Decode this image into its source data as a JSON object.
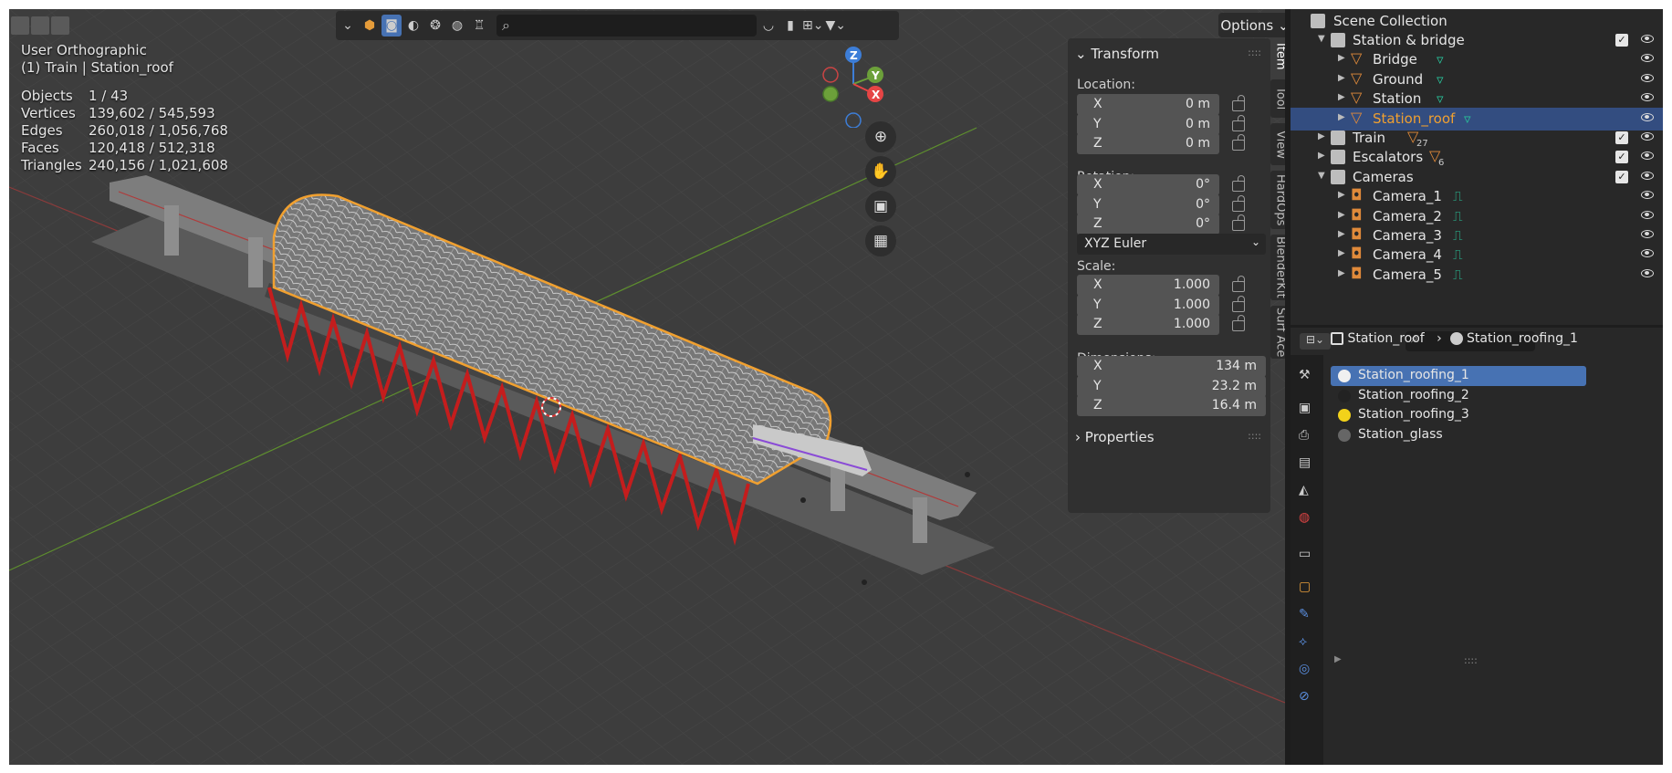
{
  "viewport": {
    "view_name": "User Orthographic",
    "context": "(1) Train | Station_roof",
    "stats": [
      {
        "label": "Objects",
        "value": "1 / 43"
      },
      {
        "label": "Vertices",
        "value": "139,602 / 545,593"
      },
      {
        "label": "Edges",
        "value": "260,018 / 1,056,768"
      },
      {
        "label": "Faces",
        "value": "120,418 / 512,318"
      },
      {
        "label": "Triangles",
        "value": "240,156 / 1,021,608"
      }
    ],
    "options_label": "Options",
    "gizmo": {
      "z": "Z",
      "y": "Y",
      "x": "X"
    }
  },
  "npanel": {
    "transform_label": "Transform",
    "location_label": "Location:",
    "location": [
      {
        "axis": "X",
        "value": "0 m"
      },
      {
        "axis": "Y",
        "value": "0 m"
      },
      {
        "axis": "Z",
        "value": "0 m"
      }
    ],
    "rotation_label": "Rotation:",
    "rotation": [
      {
        "axis": "X",
        "value": "0°"
      },
      {
        "axis": "Y",
        "value": "0°"
      },
      {
        "axis": "Z",
        "value": "0°"
      }
    ],
    "rotation_mode": "XYZ Euler",
    "scale_label": "Scale:",
    "scale": [
      {
        "axis": "X",
        "value": "1.000"
      },
      {
        "axis": "Y",
        "value": "1.000"
      },
      {
        "axis": "Z",
        "value": "1.000"
      }
    ],
    "dimensions_label": "Dimensions:",
    "dimensions": [
      {
        "axis": "X",
        "value": "134 m"
      },
      {
        "axis": "Y",
        "value": "23.2 m"
      },
      {
        "axis": "Z",
        "value": "16.4 m"
      }
    ],
    "properties_label": "Properties"
  },
  "vtabs": [
    "Item",
    "Tool",
    "View",
    "HardOps",
    "BlenderKit",
    "Surf Ace"
  ],
  "outliner": {
    "root": "Scene Collection",
    "rows": [
      {
        "name": "Station & bridge",
        "type": "collection"
      },
      {
        "name": "Bridge",
        "type": "mesh"
      },
      {
        "name": "Ground",
        "type": "mesh"
      },
      {
        "name": "Station",
        "type": "mesh"
      },
      {
        "name": "Station_roof",
        "type": "mesh",
        "selected": true
      },
      {
        "name": "Train",
        "type": "collection",
        "badge": "27"
      },
      {
        "name": "Escalators",
        "type": "collection",
        "badge": "6"
      },
      {
        "name": "Cameras",
        "type": "collection"
      },
      {
        "name": "Camera_1",
        "type": "camera"
      },
      {
        "name": "Camera_2",
        "type": "camera"
      },
      {
        "name": "Camera_3",
        "type": "camera"
      },
      {
        "name": "Camera_4",
        "type": "camera"
      },
      {
        "name": "Camera_5",
        "type": "camera"
      }
    ]
  },
  "properties": {
    "breadcrumb_object": "Station_roof",
    "breadcrumb_material": "Station_roofing_1",
    "materials": [
      {
        "name": "Station_roofing_1",
        "color": "#f0f0f0",
        "selected": true
      },
      {
        "name": "Station_roofing_2",
        "color": "#222222"
      },
      {
        "name": "Station_roofing_3",
        "color": "#f2d21a"
      },
      {
        "name": "Station_glass",
        "color": "#666666"
      }
    ]
  },
  "colors": {
    "accent": "#4772b3",
    "selection_outline": "#f0a030",
    "axis_x": "#e64545",
    "axis_y": "#6ca03a",
    "axis_z": "#3d7ed8"
  }
}
